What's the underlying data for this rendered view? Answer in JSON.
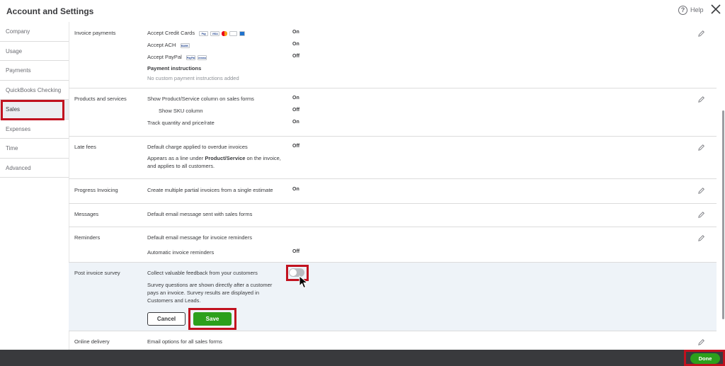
{
  "header": {
    "title": "Account and Settings",
    "help_label": "Help"
  },
  "sidebar": {
    "items": [
      {
        "label": "Company"
      },
      {
        "label": "Usage"
      },
      {
        "label": "Payments"
      },
      {
        "label": "QuickBooks Checking"
      },
      {
        "label": "Sales",
        "active": true
      },
      {
        "label": "Expenses"
      },
      {
        "label": "Time"
      },
      {
        "label": "Advanced"
      }
    ]
  },
  "sections": {
    "invoice_payments": {
      "title": "Invoice payments",
      "cards_label": "Accept Credit Cards",
      "cards_value": "On",
      "card_logos": [
        "Pay",
        "VISA",
        "",
        "",
        ""
      ],
      "ach_label": "Accept ACH",
      "ach_value": "On",
      "ach_logo": "BANK",
      "paypal_label": "Accept PayPal",
      "paypal_value": "Off",
      "paypal_logos": [
        "PayPal",
        "venmo"
      ],
      "instructions_label": "Payment instructions",
      "instructions_value": "No custom payment instructions added"
    },
    "products_services": {
      "title": "Products and services",
      "col_label": "Show Product/Service column on sales forms",
      "col_value": "On",
      "sku_label": "Show SKU column",
      "sku_value": "Off",
      "qty_label": "Track quantity and price/rate",
      "qty_value": "On"
    },
    "late_fees": {
      "title": "Late fees",
      "charge_label": "Default charge applied to overdue invoices",
      "charge_value": "Off",
      "desc_prefix": "Appears as a line under ",
      "desc_bold": "Product/Service",
      "desc_suffix": " on the invoice, and applies to all customers."
    },
    "progress_invoicing": {
      "title": "Progress Invoicing",
      "label": "Create multiple partial invoices from a single estimate",
      "value": "On"
    },
    "messages": {
      "title": "Messages",
      "label": "Default email message sent with sales forms"
    },
    "reminders": {
      "title": "Reminders",
      "label": "Default email message for invoice reminders",
      "auto_label": "Automatic invoice reminders",
      "auto_value": "Off"
    },
    "post_invoice_survey": {
      "title": "Post invoice survey",
      "label": "Collect valuable feedback from your customers",
      "desc": "Survey questions are shown directly after a customer pays an invoice. Survey results are displayed in Customers and Leads.",
      "toggle_on": false,
      "cancel_label": "Cancel",
      "save_label": "Save"
    },
    "online_delivery": {
      "title": "Online delivery",
      "label": "Email options for all sales forms"
    }
  },
  "footer": {
    "done_label": "Done"
  },
  "colors": {
    "accent_green": "#2ca01c",
    "highlight_red": "#c1121f",
    "footer_bg": "#393a3d"
  }
}
